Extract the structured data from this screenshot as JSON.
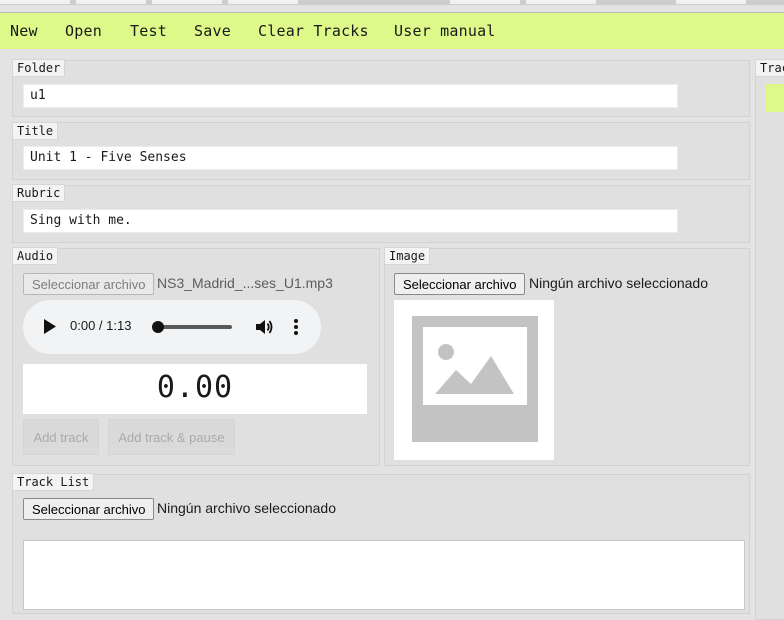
{
  "menu": {
    "new": "New",
    "open": "Open",
    "test": "Test",
    "save": "Save",
    "clear_tracks": "Clear Tracks",
    "user_manual": "User manual"
  },
  "folder": {
    "legend": "Folder",
    "value": "u1"
  },
  "title": {
    "legend": "Title",
    "value": "Unit 1 - Five Senses"
  },
  "rubric": {
    "legend": "Rubric",
    "value": "Sing with me."
  },
  "audio": {
    "legend": "Audio",
    "file_button": "Seleccionar archivo",
    "file_name": "NS3_Madrid_...ses_U1.mp3",
    "player": {
      "time": "0:00 / 1:13",
      "progress": 0.0
    },
    "timer": "0.00",
    "add_track": "Add track",
    "add_track_pause": "Add track & pause"
  },
  "image": {
    "legend": "Image",
    "file_button": "Seleccionar archivo",
    "file_name": "Ningún archivo seleccionado"
  },
  "track_list": {
    "legend": "Track List",
    "file_button": "Seleccionar archivo",
    "file_name": "Ningún archivo seleccionado"
  },
  "right_panel": {
    "legend": "Trac"
  },
  "colors": {
    "menubar": "#ddf98a",
    "page_bg": "#e3e3e3",
    "accent_chip": "#ddf98a"
  },
  "icons": [
    "play-icon",
    "volume-icon",
    "more-options-icon",
    "image-placeholder-icon"
  ]
}
